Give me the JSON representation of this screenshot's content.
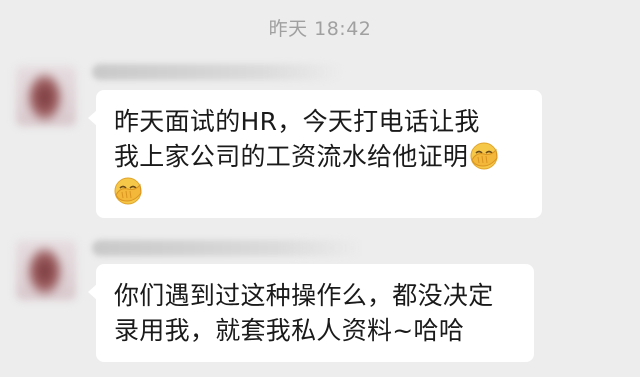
{
  "timestamp": "昨天 18:42",
  "messages": [
    {
      "line1": "昨天面试的HR，今天打电话让我",
      "line2": "我上家公司的工资流水给他证明",
      "emoji": "facepalm-emoji"
    },
    {
      "line1": "你们遇到过这种操作么，都没决定",
      "line2": "录用我，就套我私人资料~哈哈"
    }
  ],
  "colors": {
    "background": "#ededed",
    "bubble": "#ffffff",
    "text": "#1a1a1a",
    "timestamp": "#a0a0a0"
  }
}
